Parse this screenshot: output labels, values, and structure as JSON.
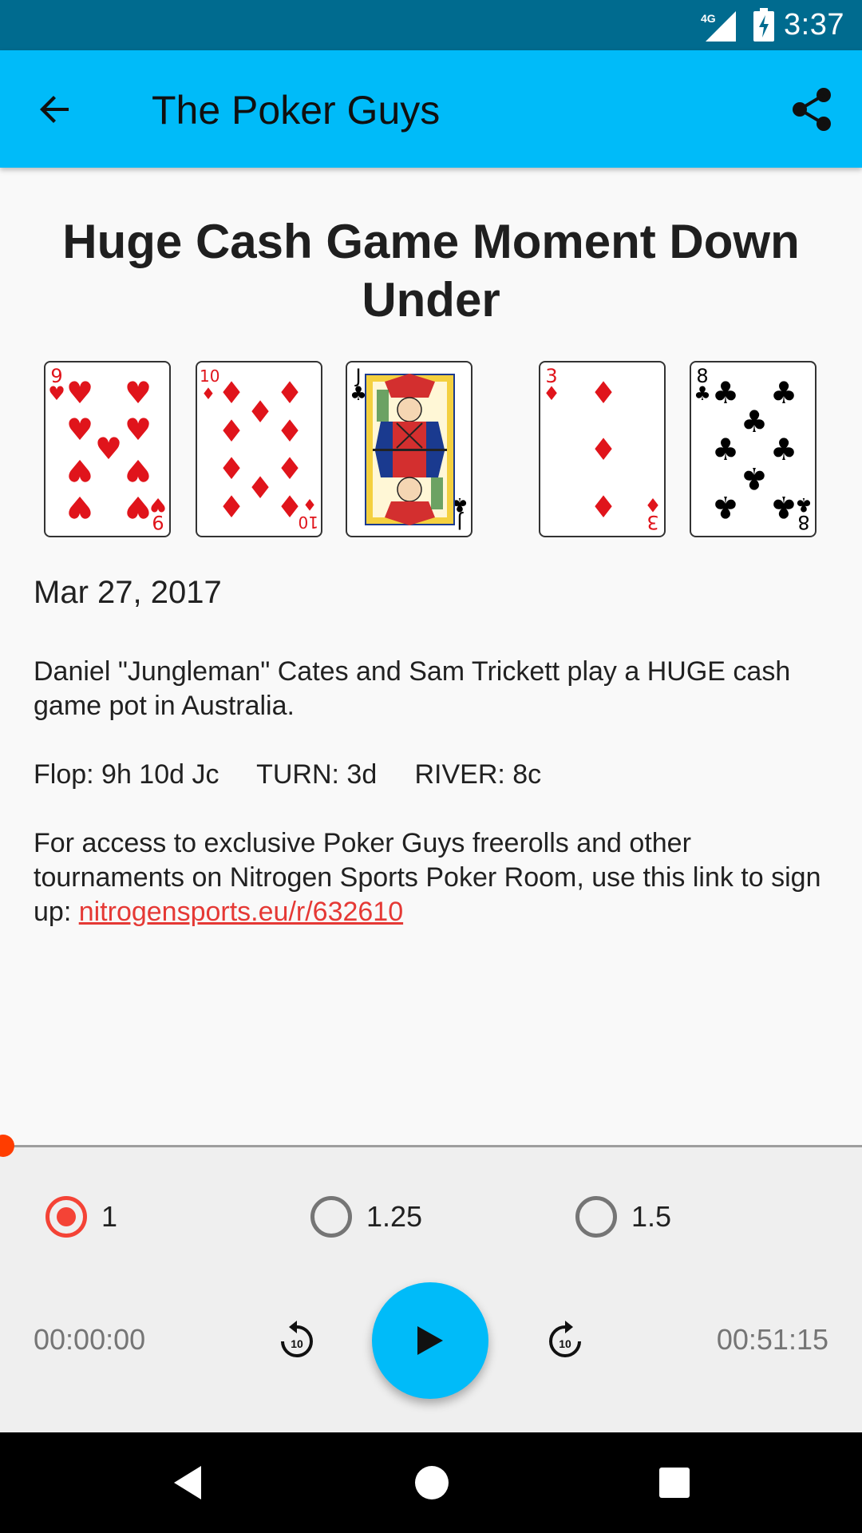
{
  "status_bar": {
    "time": "3:37",
    "network": "4G",
    "signal_icon": "signal-icon",
    "battery_icon": "battery-charging-icon"
  },
  "app_bar": {
    "title": "The Poker Guys",
    "back_icon": "arrow-back-icon",
    "share_icon": "share-icon",
    "color": "#00bbf9"
  },
  "episode": {
    "title": "Huge Cash Game Moment Down Under",
    "date": "Mar 27, 2017",
    "paragraphs": [
      "Daniel \"Jungleman\" Cates and Sam Trickett play a HUGE cash game pot in Australia.",
      "Flop: 9h 10d Jc     TURN: 3d     RIVER: 8c"
    ],
    "promo_text": "For access to exclusive Poker Guys freerolls and other tournaments on Nitrogen Sports Poker Room, use this link to sign up: ",
    "promo_link": "nitrogensports.eu/r/632610",
    "link_color": "#e53935"
  },
  "board_cards": [
    {
      "rank": "9",
      "suit": "♥",
      "color": "red"
    },
    {
      "rank": "10",
      "suit": "♦",
      "color": "red"
    },
    {
      "rank": "J",
      "suit": "♣",
      "color": "black"
    },
    {
      "rank": "3",
      "suit": "♦",
      "color": "red"
    },
    {
      "rank": "8",
      "suit": "♣",
      "color": "black"
    }
  ],
  "player": {
    "progress": 0,
    "speeds": [
      {
        "label": "1",
        "selected": true
      },
      {
        "label": "1.25",
        "selected": false
      },
      {
        "label": "1.5",
        "selected": false
      }
    ],
    "current_time": "00:00:00",
    "total_time": "00:51:15",
    "rewind_label": "10",
    "forward_label": "10",
    "accent_color": "#00bbf9",
    "thumb_color": "#ff3d00",
    "radio_color": "#f44336"
  },
  "nav_bar": {
    "back_icon": "nav-back-icon",
    "home_icon": "nav-home-icon",
    "recents_icon": "nav-recents-icon"
  }
}
